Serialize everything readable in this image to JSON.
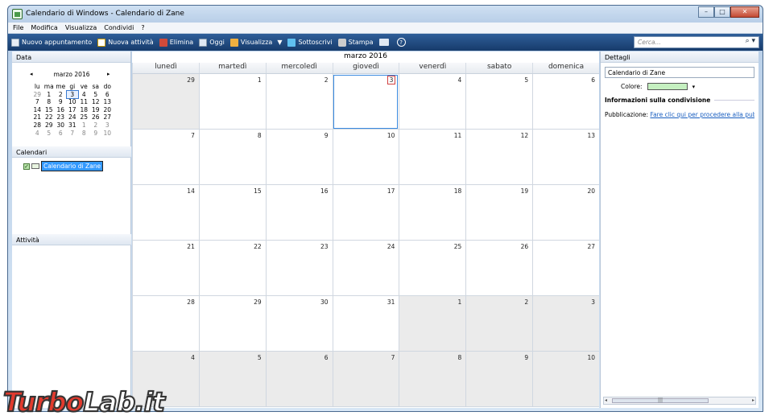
{
  "window": {
    "title": "Calendario di Windows - Calendario di Zane",
    "buttons": [
      "–",
      "□",
      "✕"
    ]
  },
  "menu": [
    "File",
    "Modifica",
    "Visualizza",
    "Condividi",
    "?"
  ],
  "toolbar": {
    "items": [
      {
        "label": "Nuovo appuntamento",
        "icon": "new-appointment-icon",
        "color": "#ffffff"
      },
      {
        "label": "Nuova attività",
        "icon": "new-task-icon",
        "color": "#f0c040"
      },
      {
        "label": "Elimina",
        "icon": "delete-icon",
        "color": "#d04a3a"
      },
      {
        "label": "Oggi",
        "icon": "today-icon",
        "color": "#ffffff"
      },
      {
        "label": "Visualizza",
        "icon": "view-icon",
        "color": "#f0b040"
      },
      {
        "label": "Sottoscrivi",
        "icon": "subscribe-icon",
        "color": "#60c0f0"
      },
      {
        "label": "Stampa",
        "icon": "print-icon",
        "color": "#dddddd"
      }
    ],
    "view_arrow": "▼",
    "help": "?"
  },
  "search": {
    "placeholder": "Cerca...",
    "icon": "⌕ ▾"
  },
  "left": {
    "date_header": "Data",
    "mini": {
      "prev": "◂",
      "next": "▸",
      "month": "marzo 2016",
      "dow": [
        "lu",
        "ma",
        "me",
        "gi",
        "ve",
        "sa",
        "do"
      ],
      "weeks": [
        [
          "29",
          "1",
          "2",
          "3",
          "4",
          "5",
          "6"
        ],
        [
          "7",
          "8",
          "9",
          "10",
          "11",
          "12",
          "13"
        ],
        [
          "14",
          "15",
          "16",
          "17",
          "18",
          "19",
          "20"
        ],
        [
          "21",
          "22",
          "23",
          "24",
          "25",
          "26",
          "27"
        ],
        [
          "28",
          "29",
          "30",
          "31",
          "1",
          "2",
          "3"
        ],
        [
          "4",
          "5",
          "6",
          "7",
          "8",
          "9",
          "10"
        ]
      ]
    },
    "calendars_header": "Calendari",
    "calendar_name": "Calendario di Zane",
    "tasks_header": "Attività"
  },
  "main": {
    "month_title": "marzo 2016",
    "dow": [
      "lunedì",
      "martedì",
      "mercoledì",
      "giovedì",
      "venerdì",
      "sabato",
      "domenica"
    ],
    "weeks": [
      [
        "29",
        "1",
        "2",
        "3",
        "4",
        "5",
        "6"
      ],
      [
        "7",
        "8",
        "9",
        "10",
        "11",
        "12",
        "13"
      ],
      [
        "14",
        "15",
        "16",
        "17",
        "18",
        "19",
        "20"
      ],
      [
        "21",
        "22",
        "23",
        "24",
        "25",
        "26",
        "27"
      ],
      [
        "28",
        "29",
        "30",
        "31",
        "1",
        "2",
        "3"
      ],
      [
        "4",
        "5",
        "6",
        "7",
        "8",
        "9",
        "10"
      ]
    ]
  },
  "details": {
    "header": "Dettagli",
    "name": "Calendario di Zane",
    "color_label": "Colore:",
    "color_value": "#c5f0c0",
    "sharing_header": "Informazioni sulla condivisione",
    "publish_label": "Pubblicazione:",
    "publish_link": "Fare clic qui per procedere alla pubblicaz",
    "scroll_left": "◂",
    "scroll_right": "▸",
    "scroll_grip": "|||"
  },
  "watermark": {
    "part1": "Turbo",
    "part2": "Lab.it"
  }
}
